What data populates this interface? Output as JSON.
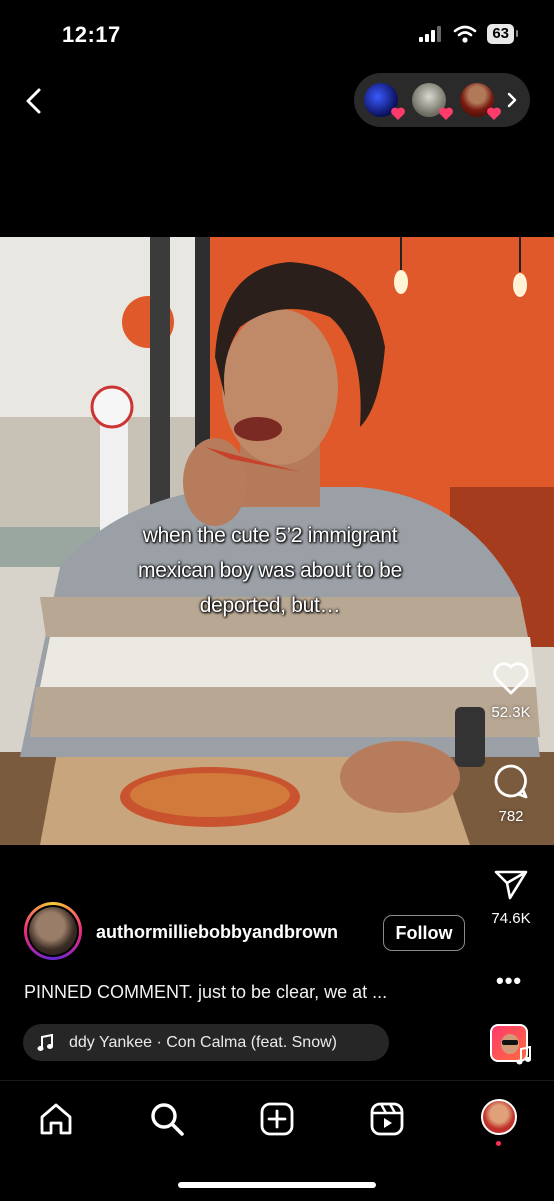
{
  "status_bar": {
    "time": "12:17",
    "battery": "63"
  },
  "header": {
    "back_icon": "chevron-left-icon",
    "faces": [
      {
        "name": "face-1",
        "color": "#1a2aa8"
      },
      {
        "name": "face-2",
        "color": "#8a8a7c"
      },
      {
        "name": "face-3",
        "color": "#5a2018"
      }
    ],
    "more_icon": "chevron-right-icon"
  },
  "video": {
    "caption_lines": [
      "when the cute 5’2 immigrant",
      "mexican boy was about to be",
      "deported, but…"
    ]
  },
  "actions": {
    "likes": "52.3K",
    "comments": "782",
    "shares": "74.6K"
  },
  "author": {
    "username": "authormilliebobbyandbrown",
    "follow_label": "Follow"
  },
  "pinned_comment": "PINNED COMMENT. just to be clear, we at ...",
  "more_label": "•••",
  "music": {
    "text": "ddy Yankee · Con Calma (feat. Snow)"
  },
  "colors": {
    "background": "#000000",
    "wall": "#e0592a",
    "accent_red": "#ff2d55"
  }
}
